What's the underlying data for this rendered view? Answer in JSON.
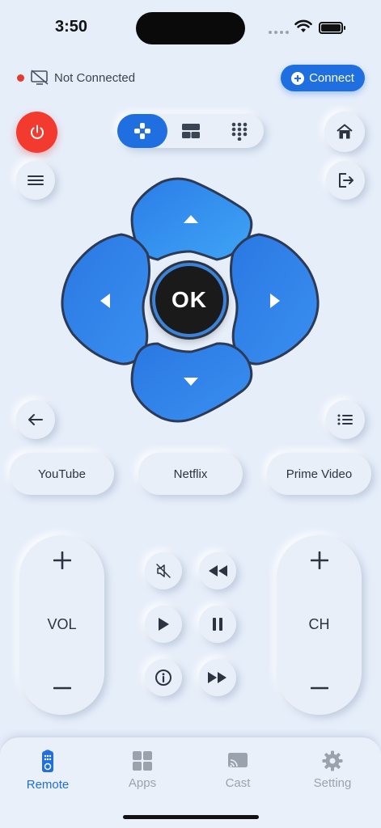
{
  "status_bar": {
    "time": "3:50"
  },
  "connection": {
    "status_text": "Not Connected",
    "connect_label": "Connect",
    "status_color": "#e53a2f"
  },
  "colors": {
    "accent": "#1f6fe0",
    "power": "#f23a2f",
    "background": "#e6eefa"
  },
  "modes": [
    {
      "icon": "gamepad-icon",
      "active": true
    },
    {
      "icon": "touchpad-icon",
      "active": false
    },
    {
      "icon": "numpad-icon",
      "active": false
    }
  ],
  "dpad": {
    "ok_label": "OK"
  },
  "apps": [
    {
      "label": "YouTube"
    },
    {
      "label": "Netflix"
    },
    {
      "label": "Prime Video"
    }
  ],
  "volume": {
    "label": "VOL"
  },
  "channel": {
    "label": "CH"
  },
  "tabs": [
    {
      "label": "Remote",
      "icon": "remote-icon",
      "active": true
    },
    {
      "label": "Apps",
      "icon": "apps-grid-icon",
      "active": false
    },
    {
      "label": "Cast",
      "icon": "cast-icon",
      "active": false
    },
    {
      "label": "Setting",
      "icon": "gear-icon",
      "active": false
    }
  ]
}
